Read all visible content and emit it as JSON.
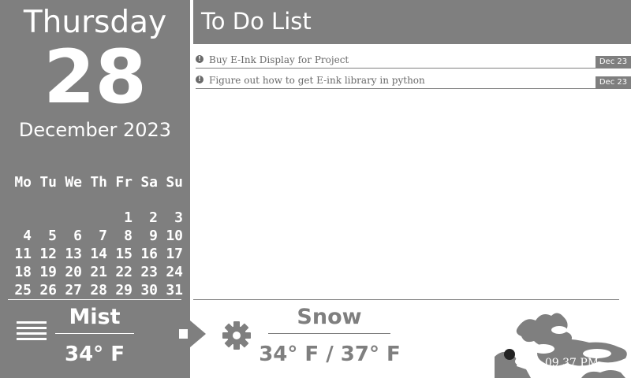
{
  "date": {
    "day_name": "Thursday",
    "day_number": "28",
    "month_year": "December 2023"
  },
  "calendar": {
    "headers": [
      "Mo",
      "Tu",
      "We",
      "Th",
      "Fr",
      "Sa",
      "Su"
    ],
    "weeks": [
      [
        "",
        "",
        "",
        "",
        "1",
        "2",
        "3"
      ],
      [
        "4",
        "5",
        "6",
        "7",
        "8",
        "9",
        "10"
      ],
      [
        "11",
        "12",
        "13",
        "14",
        "15",
        "16",
        "17"
      ],
      [
        "18",
        "19",
        "20",
        "21",
        "22",
        "23",
        "24"
      ],
      [
        "25",
        "26",
        "27",
        "28",
        "29",
        "30",
        "31"
      ]
    ]
  },
  "weather_current": {
    "condition": "Mist",
    "temperature": "34° F",
    "icon": "mist-icon"
  },
  "weather_forecast": {
    "condition": "Snow",
    "temperature": "34° F / 37° F",
    "icon": "gear-icon"
  },
  "todo": {
    "title": "To Do List",
    "items": [
      {
        "text": "Buy E-Ink Display for Project",
        "date": "Dec 23"
      },
      {
        "text": "Figure out how to get E-ink library in python",
        "date": "Dec 23"
      }
    ]
  },
  "clock": {
    "time": "09 37 PM"
  },
  "colors": {
    "panel": "#7f7f7f",
    "text_on_panel": "#ffffff",
    "muted_text": "#6a6a6a",
    "background": "#ffffff"
  }
}
